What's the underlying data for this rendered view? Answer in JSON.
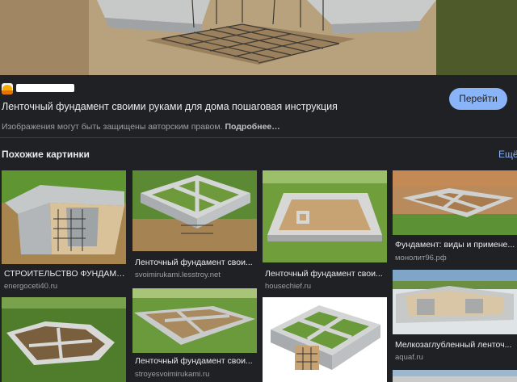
{
  "viewer": {
    "title": "Ленточный фундамент своими руками для дома пошаговая инструкция",
    "visit_button": "Перейти",
    "copyright_text": "Изображения могут быть защищены авторским правом.",
    "more_link": "Подробнее…"
  },
  "similar": {
    "heading": "Похожие картинки",
    "more": "Ещё"
  },
  "results": [
    {
      "caption": "СТРОИТЕЛЬСТВО ФУНДАМЕ...",
      "source": "energoceti40.ru"
    },
    {
      "caption": "Ленточный фундамент свои...",
      "source": "svoimirukami.lesstroy.net"
    },
    {
      "caption": "Ленточный фундамент свои...",
      "source": "housechief.ru"
    },
    {
      "caption": "Фундамент: виды и примене...",
      "source": "монолит96.рф"
    },
    {
      "caption": "",
      "source": ""
    },
    {
      "caption": "Ленточный фундамент свои...",
      "source": "stroyesvoimirukami.ru"
    },
    {
      "caption": "",
      "source": ""
    },
    {
      "caption": "Мелкозаглубленный ленточ...",
      "source": "aquaf.ru"
    }
  ],
  "colors": {
    "background": "#202124",
    "accent": "#8ab4f8",
    "text": "#e8eaed",
    "muted": "#9aa0a6"
  }
}
